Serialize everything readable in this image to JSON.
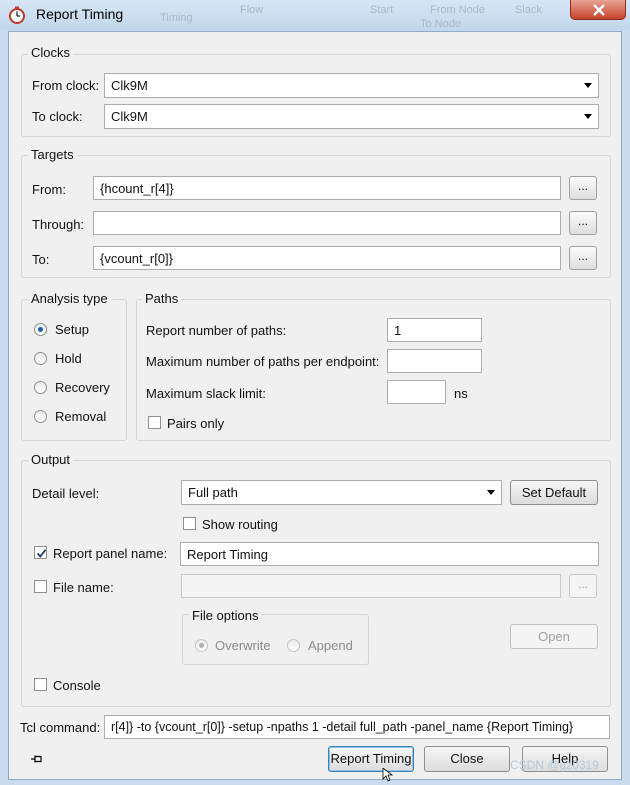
{
  "window": {
    "title": "Report Timing",
    "close_icon": "close-icon",
    "app_icon": "clock-icon"
  },
  "background": {
    "ghost_texts": [
      "Flow",
      "Slack",
      "Timing",
      "Start",
      "From Node",
      "To Node",
      "Slack"
    ]
  },
  "clocks": {
    "group_label": "Clocks",
    "from_label": "From clock:",
    "from_value": "Clk9M",
    "to_label": "To clock:",
    "to_value": "Clk9M"
  },
  "targets": {
    "group_label": "Targets",
    "from_label": "From:",
    "from_value": "{hcount_r[4]}",
    "through_label": "Through:",
    "through_value": "",
    "to_label": "To:",
    "to_value": "{vcount_r[0]}",
    "browse_label": "..."
  },
  "analysis": {
    "group_label": "Analysis type",
    "options": [
      "Setup",
      "Hold",
      "Recovery",
      "Removal"
    ],
    "selected": "Setup"
  },
  "paths": {
    "group_label": "Paths",
    "num_paths_label": "Report number of paths:",
    "num_paths_value": "1",
    "max_per_endpoint_label": "Maximum number of paths per endpoint:",
    "max_per_endpoint_value": "",
    "max_slack_label": "Maximum slack limit:",
    "max_slack_value": "",
    "slack_unit": "ns",
    "pairs_only_label": "Pairs only",
    "pairs_only_checked": false
  },
  "output": {
    "group_label": "Output",
    "detail_label": "Detail level:",
    "detail_value": "Full path",
    "set_default_label": "Set Default",
    "show_routing_label": "Show routing",
    "show_routing_checked": false,
    "report_panel_label": "Report panel name:",
    "report_panel_checked": true,
    "report_panel_value": "Report Timing",
    "file_name_label": "File name:",
    "file_name_checked": false,
    "file_name_value": "",
    "file_browse_label": "...",
    "file_options": {
      "group_label": "File options",
      "options": [
        "Overwrite",
        "Append"
      ],
      "selected": "Overwrite"
    },
    "open_label": "Open",
    "console_label": "Console",
    "console_checked": false
  },
  "tcl": {
    "label": "Tcl command:",
    "value": "r[4]} -to {vcount_r[0]} -setup -npaths 1 -detail full_path -panel_name {Report Timing}"
  },
  "footer": {
    "pin_icon": "pin-icon",
    "report_timing_label": "Report Timing",
    "close_label": "Close",
    "help_label": "Help"
  },
  "watermark": "CSDN @gz0319",
  "colors": {
    "accent": "#1c5fa6",
    "window_frame": "#c9dcef",
    "close_button": "#c7412b"
  }
}
